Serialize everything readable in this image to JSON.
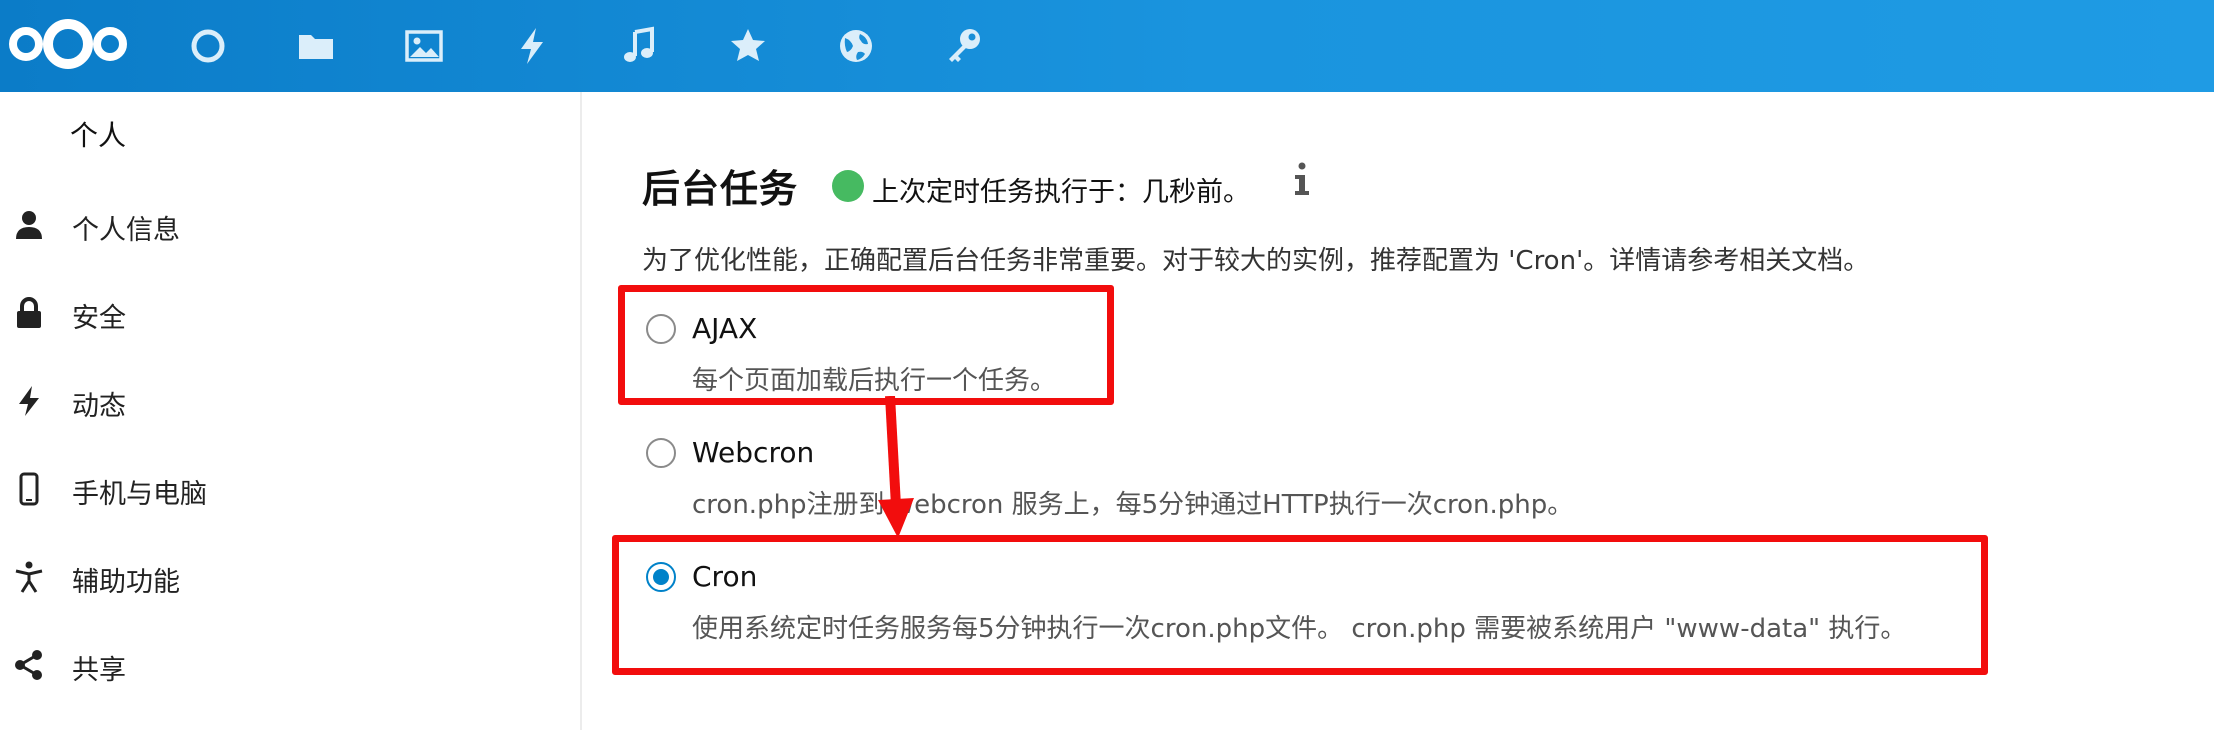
{
  "header": {
    "logo": "nextcloud-logo",
    "nav_icons": [
      {
        "name": "dashboard-icon"
      },
      {
        "name": "files-icon"
      },
      {
        "name": "photos-icon"
      },
      {
        "name": "activity-icon"
      },
      {
        "name": "music-icon"
      },
      {
        "name": "favorites-icon"
      },
      {
        "name": "globe-icon"
      },
      {
        "name": "passwords-icon"
      }
    ],
    "bar_color": "#0b7cc8"
  },
  "sidebar": {
    "heading": "个人",
    "items": [
      {
        "label": "个人信息",
        "icon": "person-icon"
      },
      {
        "label": "安全",
        "icon": "lock-icon"
      },
      {
        "label": "动态",
        "icon": "lightning-icon"
      },
      {
        "label": "手机与电脑",
        "icon": "phone-icon"
      },
      {
        "label": "辅助功能",
        "icon": "accessibility-icon"
      },
      {
        "label": "共享",
        "icon": "share-icon"
      }
    ]
  },
  "main": {
    "title": "后台任务",
    "status": {
      "color": "#46ba61",
      "text": "上次定时任务执行于：几秒前。"
    },
    "info_icon": "info-icon",
    "description": "为了优化性能，正确配置后台任务非常重要。对于较大的实例，推荐配置为 'Cron'。详情请参考相关文档。",
    "options": [
      {
        "label": "AJAX",
        "desc": "每个页面加载后执行一个任务。",
        "checked": false
      },
      {
        "label": "Webcron",
        "desc": "cron.php注册到 webcron 服务上，每5分钟通过HTTP执行一次cron.php。",
        "checked": false
      },
      {
        "label": "Cron",
        "desc": "使用系统定时任务服务每5分钟执行一次cron.php文件。 cron.php 需要被系统用户 \"www-data\" 执行。",
        "checked": true
      }
    ]
  },
  "annotation": {
    "color": "#f20d0d"
  }
}
